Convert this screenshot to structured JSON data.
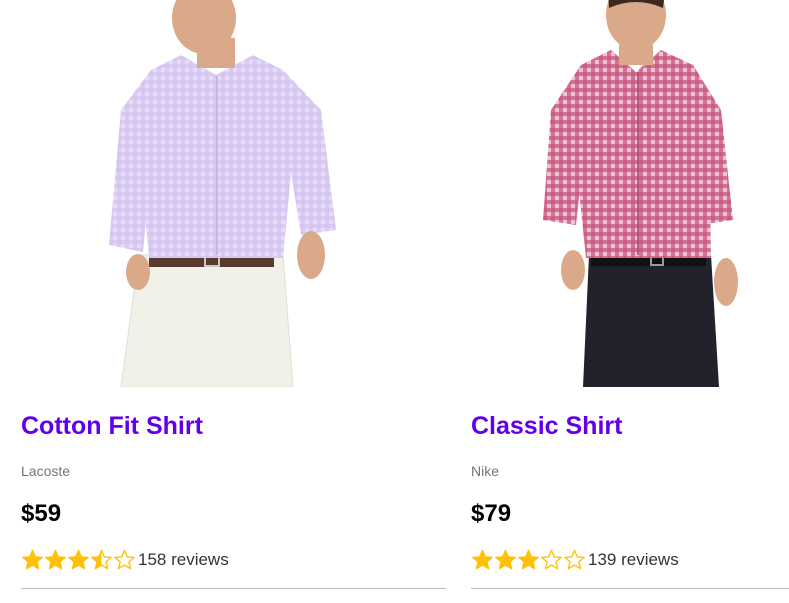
{
  "products": [
    {
      "image_alt": "Man in lavender gingham button-down shirt and white chinos",
      "title": "Cotton Fit Shirt",
      "brand": "Lacoste",
      "price": "$59",
      "rating": 3.5,
      "rating_max": 5,
      "reviews": "158 reviews",
      "shirt_color": "#d7c9f2",
      "pants_color": "#f1f1e8"
    },
    {
      "image_alt": "Man in pink gingham button-down shirt and navy chinos",
      "title": "Classic Shirt",
      "brand": "Nike",
      "price": "$79",
      "rating": 3,
      "rating_max": 5,
      "reviews": "139 reviews",
      "shirt_color": "#cf6f96",
      "pants_color": "#22222d"
    }
  ],
  "colors": {
    "title": "#6200ea",
    "star": "#ffc107",
    "divider": "#bdbdbd"
  }
}
